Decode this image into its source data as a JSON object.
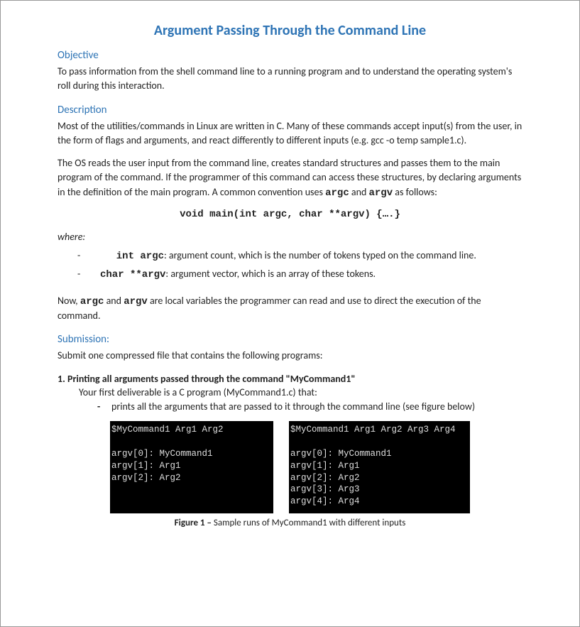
{
  "title": "Argument Passing Through the Command Line",
  "sections": {
    "objective": {
      "heading": "Objective",
      "text": "To pass information from the shell command line to a running program and to understand the operating system's roll during this interaction."
    },
    "description": {
      "heading": "Description",
      "p1": "Most of the utilities/commands in Linux are written in C. Many of these commands accept input(s) from the user, in the form of flags and arguments, and react differently to different inputs (e.g. gcc -o temp sample1.c).",
      "p2_prefix": "The OS reads the user input from the command line, creates standard structures and passes them to the main program of the command. If the programmer of this command can access these structures, by declaring arguments in the definition of the main program. A common convention uses ",
      "p2_code1": "argc",
      "p2_mid": " and ",
      "p2_code2": "argv",
      "p2_suffix": " as follows:",
      "main_signature": "void main(int argc, char **argv) {….}",
      "where_label": "where:",
      "bullet_argc_code": "int argc",
      "bullet_argc_text": ": argument count, which is the number of tokens typed on the command line.",
      "bullet_argv_code": "char **argv",
      "bullet_argv_text": ": argument vector, which is an array of these tokens.",
      "p3_prefix": "Now, ",
      "p3_code1": "argc",
      "p3_mid": " and ",
      "p3_code2": "argv",
      "p3_suffix": " are local variables the programmer can read and use to direct the execution of the command."
    },
    "submission": {
      "heading": "Submission",
      "intro": "Submit one compressed file that contains the following programs:",
      "task1_heading": "1. Printing all arguments passed through the command \"MyCommand1\"",
      "task1_line": "Your first deliverable is a C program (MyCommand1.c) that:",
      "task1_bullet": "prints all the arguments that are passed to it through the command line (see figure below)"
    }
  },
  "terminals": {
    "left": "$MyCommand1 Arg1 Arg2\n\nargv[0]: MyCommand1\nargv[1]: Arg1\nargv[2]: Arg2",
    "right": "$MyCommand1 Arg1 Arg2 Arg3 Arg4\n\nargv[0]: MyCommand1\nargv[1]: Arg1\nargv[2]: Arg2\nargv[3]: Arg3\nargv[4]: Arg4"
  },
  "figure": {
    "label": "Figure 1 – ",
    "caption": "Sample runs of MyCommand1 with different inputs"
  }
}
